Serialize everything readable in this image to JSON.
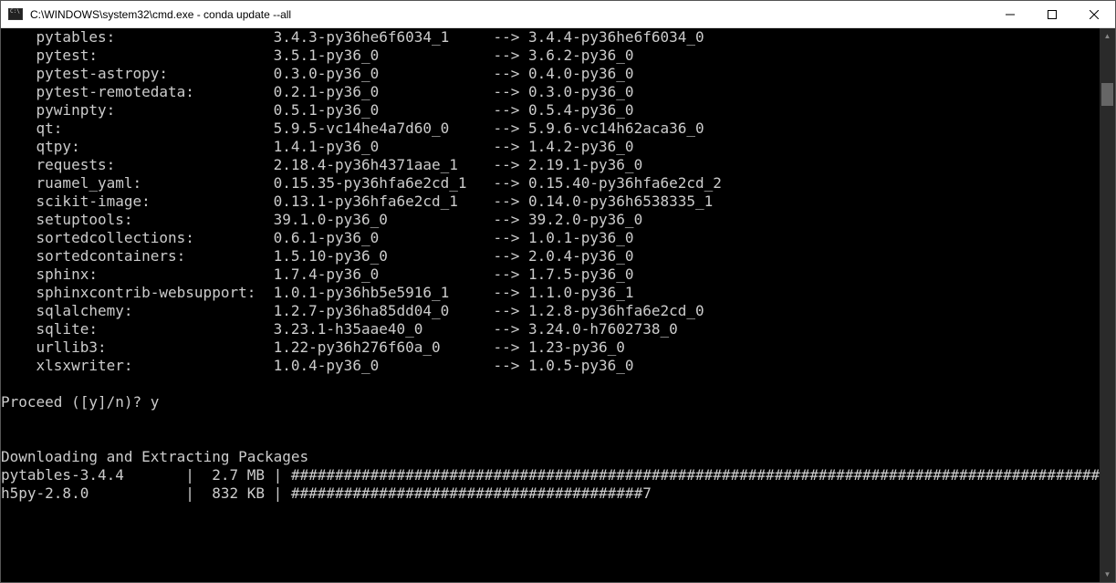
{
  "window": {
    "title": "C:\\WINDOWS\\system32\\cmd.exe - conda  update --all"
  },
  "packages": [
    {
      "name": "pytables:",
      "from": "3.4.3-py36he6f6034_1",
      "to": "3.4.4-py36he6f6034_0"
    },
    {
      "name": "pytest:",
      "from": "3.5.1-py36_0",
      "to": "3.6.2-py36_0"
    },
    {
      "name": "pytest-astropy:",
      "from": "0.3.0-py36_0",
      "to": "0.4.0-py36_0"
    },
    {
      "name": "pytest-remotedata:",
      "from": "0.2.1-py36_0",
      "to": "0.3.0-py36_0"
    },
    {
      "name": "pywinpty:",
      "from": "0.5.1-py36_0",
      "to": "0.5.4-py36_0"
    },
    {
      "name": "qt:",
      "from": "5.9.5-vc14he4a7d60_0",
      "to": "5.9.6-vc14h62aca36_0"
    },
    {
      "name": "qtpy:",
      "from": "1.4.1-py36_0",
      "to": "1.4.2-py36_0"
    },
    {
      "name": "requests:",
      "from": "2.18.4-py36h4371aae_1",
      "to": "2.19.1-py36_0"
    },
    {
      "name": "ruamel_yaml:",
      "from": "0.15.35-py36hfa6e2cd_1",
      "to": "0.15.40-py36hfa6e2cd_2"
    },
    {
      "name": "scikit-image:",
      "from": "0.13.1-py36hfa6e2cd_1",
      "to": "0.14.0-py36h6538335_1"
    },
    {
      "name": "setuptools:",
      "from": "39.1.0-py36_0",
      "to": "39.2.0-py36_0"
    },
    {
      "name": "sortedcollections:",
      "from": "0.6.1-py36_0",
      "to": "1.0.1-py36_0"
    },
    {
      "name": "sortedcontainers:",
      "from": "1.5.10-py36_0",
      "to": "2.0.4-py36_0"
    },
    {
      "name": "sphinx:",
      "from": "1.7.4-py36_0",
      "to": "1.7.5-py36_0"
    },
    {
      "name": "sphinxcontrib-websupport:",
      "from": "1.0.1-py36hb5e5916_1",
      "to": "1.1.0-py36_1"
    },
    {
      "name": "sqlalchemy:",
      "from": "1.2.7-py36ha85dd04_0",
      "to": "1.2.8-py36hfa6e2cd_0"
    },
    {
      "name": "sqlite:",
      "from": "3.23.1-h35aae40_0",
      "to": "3.24.0-h7602738_0"
    },
    {
      "name": "urllib3:",
      "from": "1.22-py36h276f60a_0",
      "to": "1.23-py36_0"
    },
    {
      "name": "xlsxwriter:",
      "from": "1.0.4-py36_0",
      "to": "1.0.5-py36_0"
    }
  ],
  "prompt": {
    "text": "Proceed ([y]/n)? ",
    "input": "y"
  },
  "section_header": "Downloading and Extracting Packages",
  "downloads": [
    {
      "name": "pytables-3.4.4",
      "size": "2.7 MB",
      "bar": "################################################################################################",
      "percent": "100%"
    },
    {
      "name": "h5py-2.8.0",
      "size": "832 KB",
      "bar": "########################################7",
      "percent": " 43%"
    }
  ],
  "arrow": "-->",
  "separator": "|"
}
